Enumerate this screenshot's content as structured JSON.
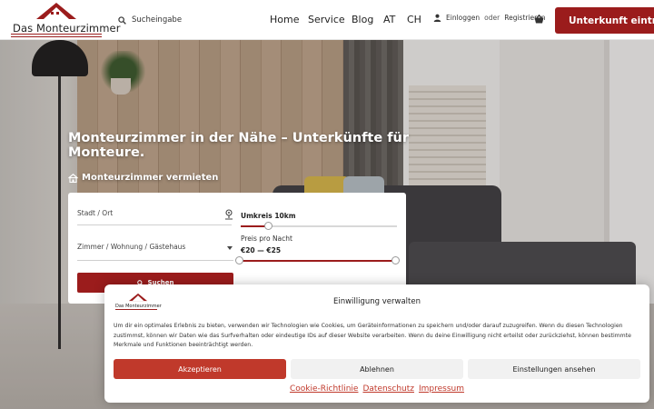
{
  "header": {
    "logo_text": "Das Monteurzimmer",
    "search_label": "Sucheingabe",
    "nav": [
      "Home",
      "Service",
      "Blog",
      "AT",
      "CH"
    ],
    "login_prefix": "Einloggen",
    "login_mid": "oder",
    "login_suffix": "Registrieren",
    "cta_label": "Unterkunft eintragen"
  },
  "hero": {
    "title": "Monteurzimmer in der Nähe – Unterkünfte für Monteure.",
    "rent_link": "Monteurzimmer vermieten"
  },
  "form": {
    "city_label": "Stadt / Ort",
    "room_type_label": "Zimmer / Wohnung / Gästehaus",
    "radius_label": "Umkreis 10km",
    "radius_fraction": 0.18,
    "price_label": "Preis pro Nacht",
    "price_range": "€20 — €25",
    "search_button": "Suchen"
  },
  "consent": {
    "logo_text": "Das Monteurzimmer",
    "title": "Einwilligung verwalten",
    "text": "Um dir ein optimales Erlebnis zu bieten, verwenden wir Technologien wie Cookies, um Geräteinformationen zu speichern und/oder darauf zuzugreifen. Wenn du diesen Technologien zustimmst, können wir Daten wie das Surfverhalten oder eindeutige IDs auf dieser Website verarbeiten. Wenn du deine Einwilligung nicht erteilst oder zurückziehst, können bestimmte Merkmale und Funktionen beeinträchtigt werden.",
    "accept": "Akzeptieren",
    "deny": "Ablehnen",
    "settings": "Einstellungen ansehen",
    "links": [
      "Cookie-Richtlinie",
      "Datenschutz",
      "Impressum"
    ]
  },
  "colors": {
    "brand": "#9b1c1c",
    "accept": "#c0392b"
  }
}
